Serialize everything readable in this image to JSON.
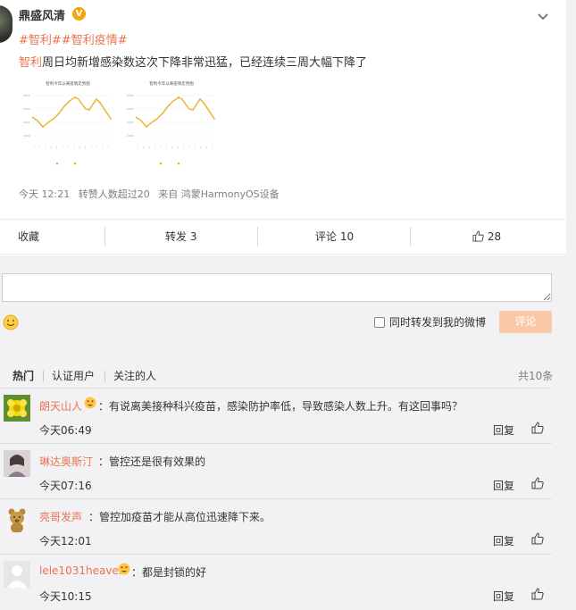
{
  "post": {
    "author": "鼎盛风清",
    "hashtags": [
      "#智利#",
      "#智利疫情#"
    ],
    "mention": "智利",
    "text": "周日均新增感染数这次下降非常迅猛，已经连续三周大幅下降了",
    "meta": {
      "time": "今天 12:21",
      "repost_count_text": "转赞人数超过20",
      "source": "来自 鸿蒙HarmonyOS设备"
    },
    "thumbnail_title": "智利今年以来疫情走势图"
  },
  "actions": {
    "favorite": "收藏",
    "repost": "转发 3",
    "comment": "评论 10",
    "like": "28"
  },
  "composer": {
    "placeholder": "",
    "repost_checkbox_label": "同时转发到我的微博",
    "submit": "评论"
  },
  "tabs": [
    "热门",
    "认证用户",
    "关注的人"
  ],
  "total": "共10条",
  "comments": [
    {
      "name": "朗天山人",
      "text": "：有说离美接种科兴疫苗，感染防护率低，导致感染人数上升。有这回事吗？",
      "time": "今天06:49",
      "reply": "回复",
      "avatar": "yellow-flower"
    },
    {
      "name": "琳达奥斯汀",
      "text": "：管控还是很有效果的",
      "time": "今天07:16",
      "reply": "回复",
      "avatar": "portrait"
    },
    {
      "name": "亮哥发声",
      "text": "：管控加疫苗才能从高位迅速降下来。",
      "time": "今天12:01",
      "reply": "回复",
      "avatar": "bear"
    },
    {
      "name": "lele1031heaven",
      "text": "：都是封锁的好",
      "time": "今天10:15",
      "reply": "回复",
      "avatar": "default-person"
    }
  ],
  "colors": {
    "accent": "#eb7350",
    "submit_disabled": "#fbc9a8",
    "link_blue": "#507daf"
  }
}
